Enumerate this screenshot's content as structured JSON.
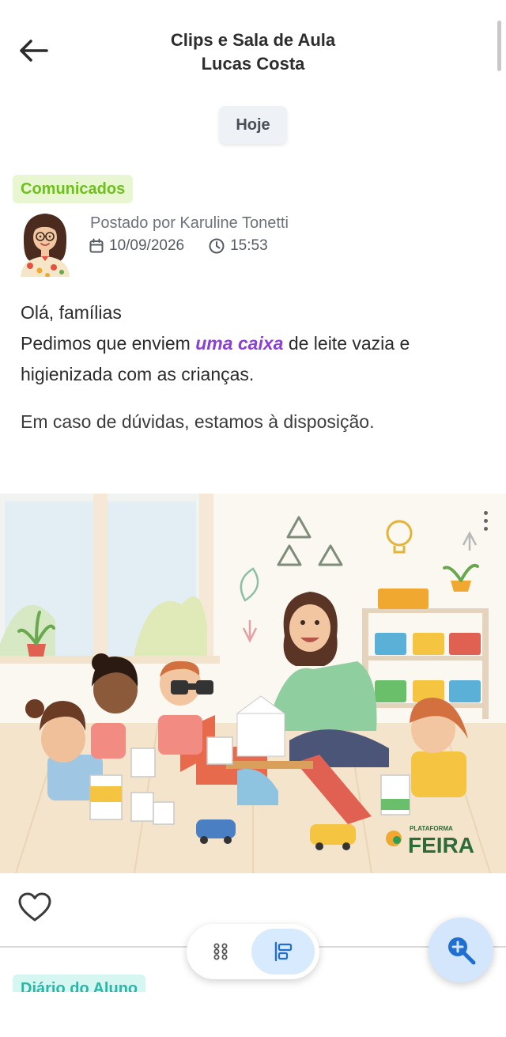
{
  "header": {
    "title_line1": "Clips e Sala de Aula",
    "title_line2": "Lucas Costa",
    "back_icon": "arrow-left-icon"
  },
  "date_separator": "Hoje",
  "post": {
    "category": "Comunicados",
    "category_color": "#6dc11b",
    "posted_by": "Postado por Karuline Tonetti",
    "date": "10/09/2026",
    "time": "15:53",
    "body": {
      "greeting": "Olá, famílias",
      "line_before": "Pedimos que enviem ",
      "highlight": "uma caixa",
      "line_after": " de leite vazia e higienizada com as crianças.",
      "paragraph2": "Em caso de dúvidas, estamos à disposição."
    },
    "image": {
      "logo_small": "PLATAFORMA",
      "logo_big": "FEIRA"
    }
  },
  "next_post": {
    "category": "Diário do Aluno",
    "category_color": "#2ab7a6"
  },
  "controls": {
    "like_icon": "heart-outline-icon",
    "grid_view_icon": "grid-icon",
    "list_view_icon": "list-view-icon",
    "zoom_icon": "zoom-in-icon",
    "accent": "#1f6fd1"
  }
}
